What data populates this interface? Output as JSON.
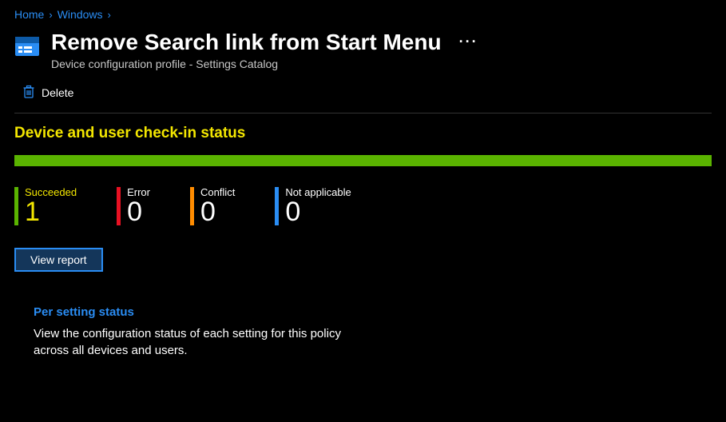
{
  "breadcrumb": {
    "items": [
      "Home",
      "Windows"
    ]
  },
  "header": {
    "title": "Remove Search link from Start Menu",
    "subtitle": "Device configuration profile - Settings Catalog"
  },
  "toolbar": {
    "delete_label": "Delete"
  },
  "section": {
    "heading": "Device and user check-in status"
  },
  "stats": {
    "succeeded": {
      "label": "Succeeded",
      "value": "1"
    },
    "error": {
      "label": "Error",
      "value": "0"
    },
    "conflict": {
      "label": "Conflict",
      "value": "0"
    },
    "na": {
      "label": "Not applicable",
      "value": "0"
    }
  },
  "actions": {
    "view_report": "View report"
  },
  "card": {
    "title": "Per setting status",
    "desc": "View the configuration status of each setting for this policy across all devices and users."
  },
  "colors": {
    "accent": "#2a8df4",
    "success": "#5ab300",
    "error": "#e81123",
    "warn": "#ff8c00",
    "highlight": "#f3e600"
  }
}
